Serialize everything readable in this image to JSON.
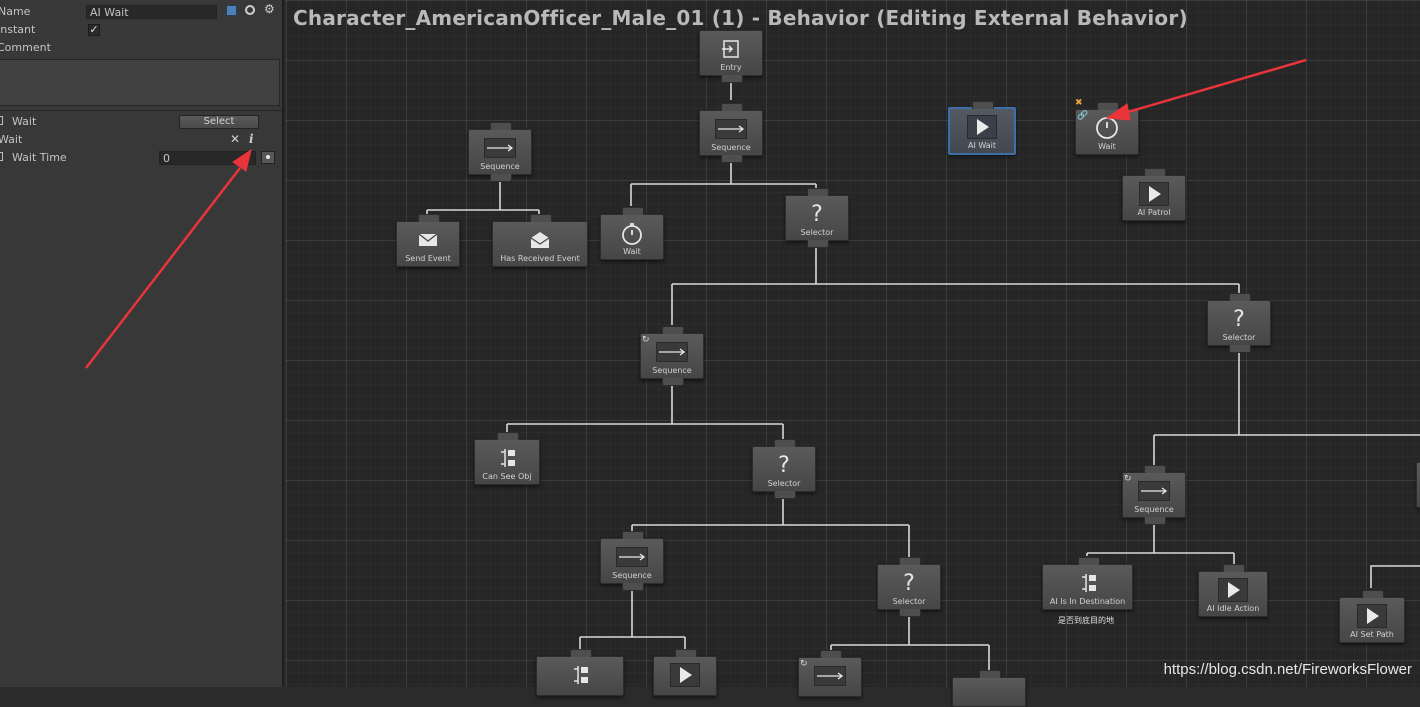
{
  "inspector": {
    "name_label": "Name",
    "name_value": "AI Wait",
    "instant_label": "Instant",
    "instant_checked": "✓",
    "comment_label": "Comment",
    "task_label": "Wait",
    "select_button": "Select",
    "wait_label": "Wait",
    "wait_time_label": "Wait Time",
    "wait_time_value": "0",
    "close_glyph": "✕",
    "info_glyph": "i"
  },
  "graph": {
    "title": "Character_AmericanOfficer_Male_01 (1) - Behavior (Editing External Behavior)",
    "watermark": "https://blog.csdn.net/FireworksFlower",
    "comment_ai_is_in_destination": "是否到底目的地",
    "nodes": {
      "entry": "Entry",
      "sequence_main": "Sequence",
      "sequence_event": "Sequence",
      "send_event": "Send Event",
      "has_received_event": "Has Received Event",
      "wait_main": "Wait",
      "selector_main": "Selector",
      "ai_wait": "AI Wait",
      "wait_selected": "Wait",
      "ai_patrol": "AI Patrol",
      "sequence_left": "Sequence",
      "selector_right": "Selector",
      "can_see_obj": "Can See Obj",
      "selector_mid": "Selector",
      "sequence_right": "Sequence",
      "ai_is_in_destination": "AI Is In Destination",
      "ai_idle_action": "AI Idle Action",
      "ai_set_path": "AI Set Path",
      "sequence_low": "Sequence",
      "selector_low": "Selector"
    }
  },
  "colors": {
    "selected_border": "#3d6fa8",
    "annotation_arrow": "#e8343a"
  }
}
